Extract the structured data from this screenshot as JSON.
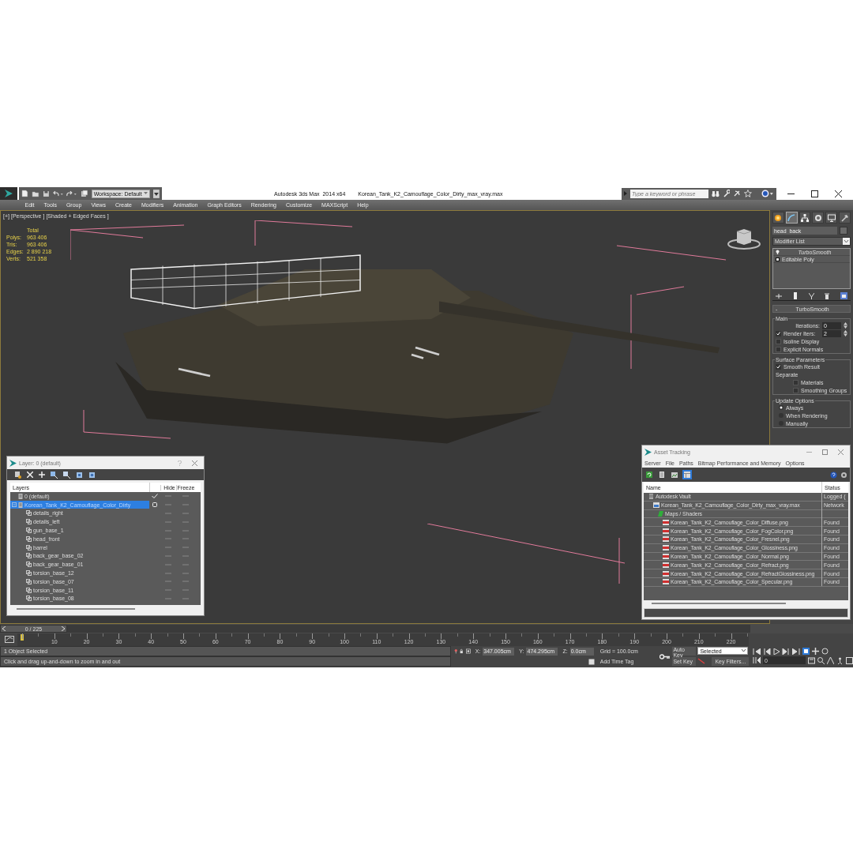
{
  "title_bar": {
    "workspace": "Workspace: Default",
    "app_title": "Autodesk 3ds Max  2014 x64",
    "file_name": "Korean_Tank_K2_Camouflage_Color_Dirty_max_vray.max",
    "search": {
      "placeholder": "Type a keyword or phrase"
    }
  },
  "menu": [
    "Edit",
    "Tools",
    "Group",
    "Views",
    "Create",
    "Modifiers",
    "Animation",
    "Graph Editors",
    "Rendering",
    "Customize",
    "MAXScript",
    "Help"
  ],
  "viewport": {
    "labels": [
      "[+]",
      "[Perspective ]",
      "[Shaded + Edged Faces ]"
    ],
    "stats_heading": "Total",
    "stats": [
      {
        "label": "Polys:",
        "value": "963 406"
      },
      {
        "label": "Tris:",
        "value": "963 406"
      },
      {
        "label": "Edges:",
        "value": "2 890 218"
      },
      {
        "label": "Verts:",
        "value": "521 358"
      }
    ]
  },
  "command_panel": {
    "tabs": [
      {
        "kind": "create",
        "selected": false
      },
      {
        "kind": "modify",
        "selected": true
      },
      {
        "kind": "hierarchy",
        "selected": false
      },
      {
        "kind": "motion",
        "selected": false
      },
      {
        "kind": "display",
        "selected": false
      },
      {
        "kind": "utilities",
        "selected": false
      }
    ],
    "object_name": "head_back",
    "modifier_list": "Modifier List",
    "stack": [
      {
        "kind": "modifier",
        "label": "TurboSmooth"
      },
      {
        "kind": "base",
        "label": "Editable Poly"
      }
    ],
    "rollout": {
      "collapse": "-",
      "title": "TurboSmooth",
      "groups": [
        {
          "title": "Main",
          "controls": [
            {
              "kind": "spinner",
              "label": "Iterations:",
              "value": "0"
            },
            {
              "kind": "check_spinner",
              "label": "Render Iters:",
              "checked": true,
              "value": "2"
            },
            {
              "kind": "checkbox",
              "label": "Isoline Display",
              "checked": false
            },
            {
              "kind": "checkbox",
              "label": "Explicit Normals",
              "checked": false
            }
          ]
        },
        {
          "title": "Surface Parameters",
          "controls": [
            {
              "kind": "checkbox",
              "label": "Smooth Result",
              "checked": true
            },
            {
              "kind": "text",
              "label": "Separate"
            },
            {
              "kind": "subcheckbox",
              "label": "Materials",
              "checked": false
            },
            {
              "kind": "subcheckbox",
              "label": "Smoothing Groups",
              "checked": false
            }
          ]
        },
        {
          "title": "Update Options",
          "controls": [
            {
              "kind": "radio",
              "label": "Always",
              "selected": true
            },
            {
              "kind": "radio",
              "label": "When Rendering",
              "selected": false
            },
            {
              "kind": "radio",
              "label": "Manually",
              "selected": false
            }
          ]
        }
      ]
    }
  },
  "layer_dialog": {
    "title": "Layer: 0 (default)",
    "columns": [
      "Layers",
      "Hide",
      "Freeze"
    ],
    "layers": [
      {
        "label": "0 (default)",
        "current": true,
        "selected": false
      },
      {
        "label": "Korean_Tank_K2_Camouflage_Color_Dirty",
        "current": false,
        "selected": true,
        "expanded": true,
        "children": [
          {
            "label": "details_right"
          },
          {
            "label": "details_left"
          },
          {
            "label": "gun_base_1"
          },
          {
            "label": "head_front"
          },
          {
            "label": "barrel"
          },
          {
            "label": "back_gear_base_02"
          },
          {
            "label": "back_gear_base_01"
          },
          {
            "label": "torsion_base_12"
          },
          {
            "label": "torsion_base_07"
          },
          {
            "label": "torsion_base_11"
          },
          {
            "label": "torsion_base_08"
          }
        ]
      }
    ]
  },
  "asset_tracking": {
    "title": "Asset Tracking",
    "menu": [
      "Server",
      "File",
      "Paths",
      "Bitmap Performance and Memory",
      "Options"
    ],
    "toolbar": [
      {
        "selected": false
      },
      {
        "selected": false
      },
      {
        "selected": false
      },
      {
        "selected": true
      }
    ],
    "columns": [
      "Name",
      "Status"
    ],
    "tree": [
      {
        "kind": "vault",
        "name": "Autodesk Vault",
        "status": "Logged (",
        "children": [
          {
            "kind": "max",
            "name": "Korean_Tank_K2_Camouflage_Color_Dirty_max_vray.max",
            "status": "Network",
            "children": [
              {
                "kind": "folder",
                "name": "Maps / Shaders",
                "children": [
                  {
                    "kind": "png",
                    "name": "Korean_Tank_K2_Camouflage_Color_Diffuse.png",
                    "status": "Found"
                  },
                  {
                    "kind": "png",
                    "name": "Korean_Tank_K2_Camouflage_Color_FogColor.png",
                    "status": "Found"
                  },
                  {
                    "kind": "png",
                    "name": "Korean_Tank_K2_Camouflage_Color_Fresnel.png",
                    "status": "Found"
                  },
                  {
                    "kind": "png",
                    "name": "Korean_Tank_K2_Camouflage_Color_Glossiness.png",
                    "status": "Found"
                  },
                  {
                    "kind": "png",
                    "name": "Korean_Tank_K2_Camouflage_Color_Normal.png",
                    "status": "Found"
                  },
                  {
                    "kind": "png",
                    "name": "Korean_Tank_K2_Camouflage_Color_Refract.png",
                    "status": "Found"
                  },
                  {
                    "kind": "png",
                    "name": "Korean_Tank_K2_Camouflage_Color_RefractGlossiness.png",
                    "status": "Found"
                  },
                  {
                    "kind": "png",
                    "name": "Korean_Tank_K2_Camouflage_Color_Specular.png",
                    "status": "Found"
                  }
                ]
              }
            ]
          }
        ]
      }
    ]
  },
  "timeline": {
    "frame_counter": "0 / 225",
    "level": 0,
    "ticks": [
      "10",
      "20",
      "30",
      "40",
      "50",
      "60",
      "70",
      "80",
      "90",
      "100",
      "110",
      "120",
      "130",
      "140",
      "150",
      "160",
      "170",
      "180",
      "190",
      "200",
      "210",
      "220"
    ]
  },
  "status_bar": {
    "selection": "1 Object Selected",
    "prompt": "Click and drag up-and-down to zoom in and out",
    "coords": [
      {
        "label": "X:",
        "value": "347.005cm"
      },
      {
        "label": "Y:",
        "value": "474.295cm"
      },
      {
        "label": "Z:",
        "value": "0.0cm"
      }
    ],
    "grid": "Grid = 100.0cm",
    "time_tag": "Add Time Tag",
    "auto_key": "Auto Key",
    "key_mode": "Selected",
    "set_key": "Set Key",
    "key_filters": "Key Filters...",
    "current_frame": "0"
  }
}
